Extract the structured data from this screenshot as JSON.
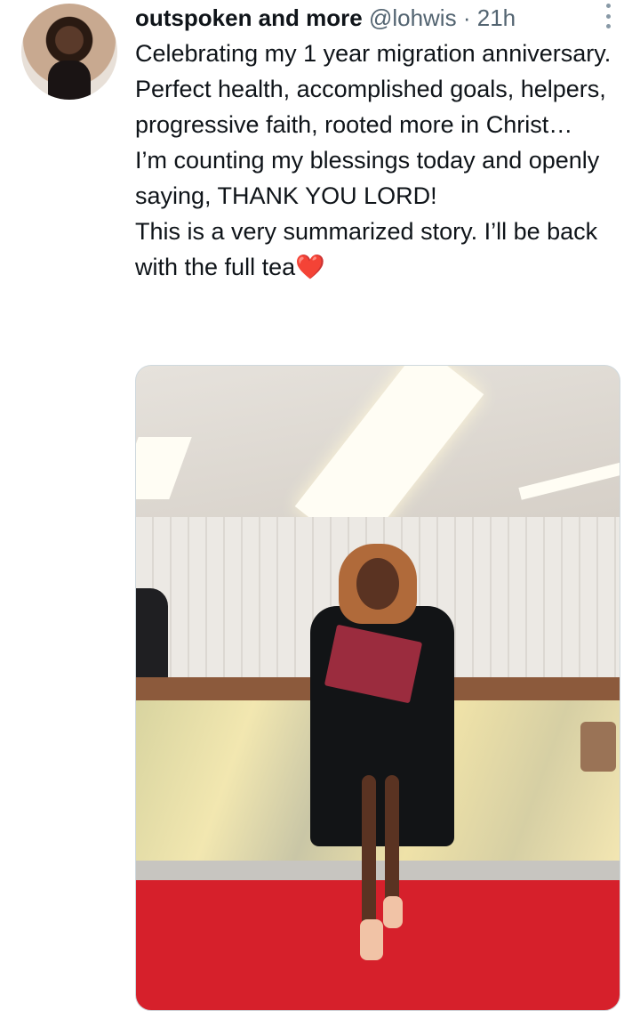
{
  "tweet": {
    "author_name": "outspoken and more",
    "handle": "@lohwis",
    "separator": "·",
    "time": "21h",
    "text_lines": [
      "Celebrating my 1 year migration anniversary. Perfect health, accomplished goals, helpers, progressive faith, rooted more in Christ…",
      "I’m counting my blessings today and openly saying, THANK YOU LORD!",
      "This is a very summarized story. I’ll be back with the full tea"
    ],
    "heart_emoji": "❤️"
  },
  "icons": {
    "more": "more-vertical-icon"
  }
}
